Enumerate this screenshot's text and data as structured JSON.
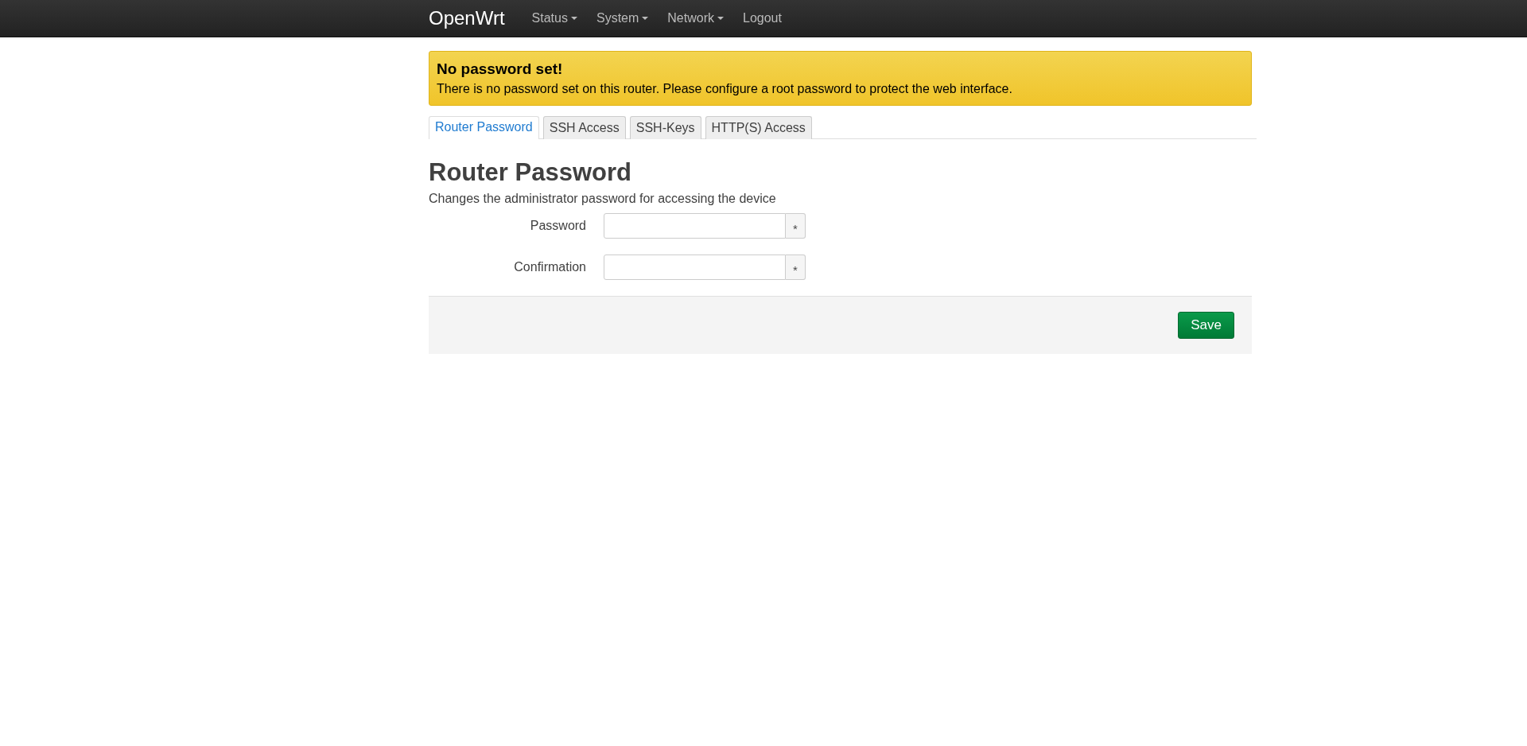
{
  "navbar": {
    "brand": "OpenWrt",
    "items": [
      {
        "label": "Status",
        "has_menu": true
      },
      {
        "label": "System",
        "has_menu": true
      },
      {
        "label": "Network",
        "has_menu": true
      },
      {
        "label": "Logout",
        "has_menu": false
      }
    ]
  },
  "alert": {
    "title": "No password set!",
    "message": "There is no password set on this router. Please configure a root password to protect the web interface."
  },
  "tabs": [
    {
      "label": "Router Password",
      "selected": true
    },
    {
      "label": "SSH Access",
      "selected": false
    },
    {
      "label": "SSH-Keys",
      "selected": false
    },
    {
      "label": "HTTP(S) Access",
      "selected": false
    }
  ],
  "section": {
    "title": "Router Password",
    "description": "Changes the administrator password for accessing the device",
    "fields": [
      {
        "label": "Password",
        "reveal": "*"
      },
      {
        "label": "Confirmation",
        "reveal": "*"
      }
    ]
  },
  "actions": {
    "buttons": [
      "Save"
    ]
  }
}
